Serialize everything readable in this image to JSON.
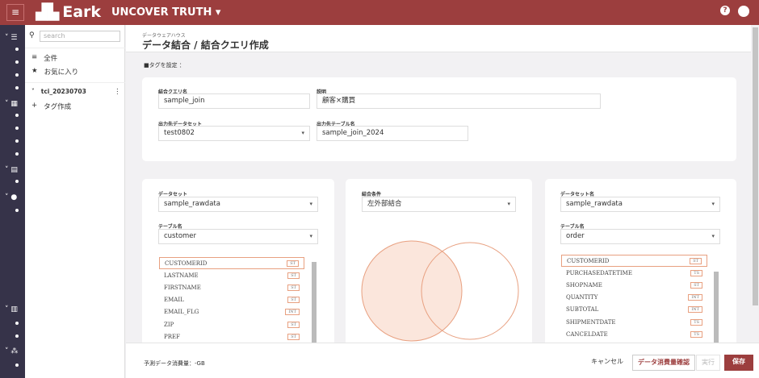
{
  "header": {
    "brand": "Eark",
    "project": "UNCOVER TRUTH ▾",
    "help_icon": "?",
    "user_icon": "user"
  },
  "sidebar": {
    "search_placeholder": "search",
    "items": [
      {
        "icon": "≡",
        "label": "全件"
      },
      {
        "icon": "★",
        "label": "お気に入り"
      }
    ],
    "group": "tci_20230703",
    "add_tag": "タグ作成"
  },
  "main": {
    "breadcrumb": "データウェアハウス",
    "title": "データ結合 / 結合クエリ作成",
    "tag_label": "タグを設定 ："
  },
  "form": {
    "query_name_label": "結合クエリ名",
    "query_name": "sample_join",
    "desc_label": "説明",
    "desc": "顧客×購買",
    "out_dataset_label": "出力先データセット",
    "out_dataset": "test0802",
    "out_table_label": "出力先テーブル名",
    "out_table": "sample_join_2024"
  },
  "left": {
    "dataset_label": "データセット",
    "dataset": "sample_rawdata",
    "table_label": "テーブル名",
    "table": "customer",
    "columns": [
      {
        "name": "CUSTOMERID",
        "type": "ST"
      },
      {
        "name": "LASTNAME",
        "type": "ST"
      },
      {
        "name": "FIRSTNAME",
        "type": "ST"
      },
      {
        "name": "EMAIL",
        "type": "ST"
      },
      {
        "name": "EMAIL_FLG",
        "type": "INT"
      },
      {
        "name": "ZIP",
        "type": "ST"
      },
      {
        "name": "PREF",
        "type": "ST"
      }
    ]
  },
  "join": {
    "label": "結合条件",
    "type": "左外部結合"
  },
  "right": {
    "dataset_label": "データセット名",
    "dataset": "sample_rawdata",
    "table_label": "テーブル名",
    "table": "order",
    "columns": [
      {
        "name": "CUSTOMERID",
        "type": "ST"
      },
      {
        "name": "PURCHASEDATETIME",
        "type": "TS"
      },
      {
        "name": "SHOPNAME",
        "type": "ST"
      },
      {
        "name": "QUANTITY",
        "type": "INT"
      },
      {
        "name": "SUBTOTAL",
        "type": "INT"
      },
      {
        "name": "SHIPMENTDATE",
        "type": "TS"
      },
      {
        "name": "CANCELDATE",
        "type": "TS"
      }
    ]
  },
  "footer": {
    "estimate": "予測データ消費量：-GB",
    "cancel": "キャンセル",
    "check": "データ消費量確認",
    "run": "実行",
    "save": "保存"
  },
  "colors": {
    "brand": "#9c3e3e",
    "rail": "#363349",
    "venn": "#e8a080"
  }
}
